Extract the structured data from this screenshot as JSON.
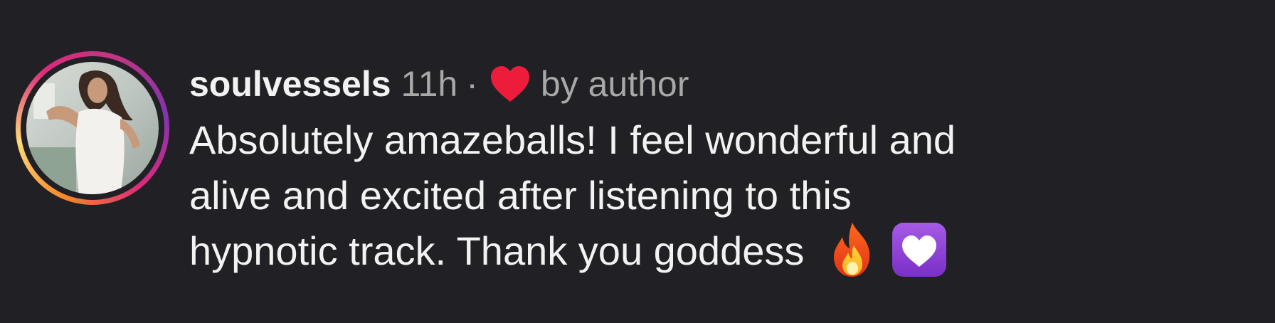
{
  "comment": {
    "username": "soulvessels",
    "time": "11h",
    "separator": "·",
    "liked_by": "by author",
    "text_lines": [
      "Absolutely amazeballs!  I feel wonderful and",
      "alive and excited after listening to this",
      "hypnotic track. Thank you goddess"
    ],
    "emojis": [
      "fire-icon",
      "white-heart-on-purple-icon"
    ],
    "heart_icon": "red-heart-icon"
  },
  "colors": {
    "background": "#212125",
    "primary_text": "#f2f2f2",
    "secondary_text": "#a8a8a8",
    "heart": "#ed1c3a",
    "purple_heart_bg": "#8e3fd6"
  }
}
